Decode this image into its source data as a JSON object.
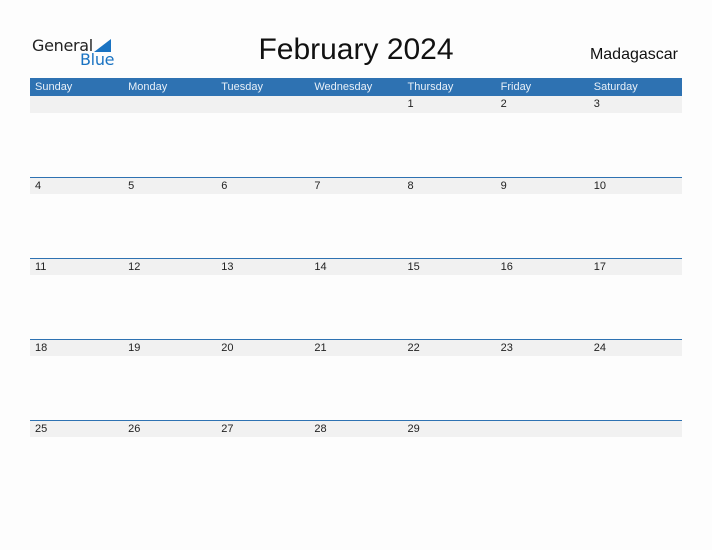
{
  "logo": {
    "line1": "General",
    "line2": "Blue"
  },
  "title": "February 2024",
  "country": "Madagascar",
  "weekdays": [
    "Sunday",
    "Monday",
    "Tuesday",
    "Wednesday",
    "Thursday",
    "Friday",
    "Saturday"
  ],
  "weeks": [
    [
      "",
      "",
      "",
      "",
      "1",
      "2",
      "3"
    ],
    [
      "4",
      "5",
      "6",
      "7",
      "8",
      "9",
      "10"
    ],
    [
      "11",
      "12",
      "13",
      "14",
      "15",
      "16",
      "17"
    ],
    [
      "18",
      "19",
      "20",
      "21",
      "22",
      "23",
      "24"
    ],
    [
      "25",
      "26",
      "27",
      "28",
      "29",
      "",
      ""
    ]
  ],
  "colors": {
    "accent": "#2e72b2",
    "logo_blue": "#1a73c2",
    "day_strip": "#f1f1f1"
  }
}
